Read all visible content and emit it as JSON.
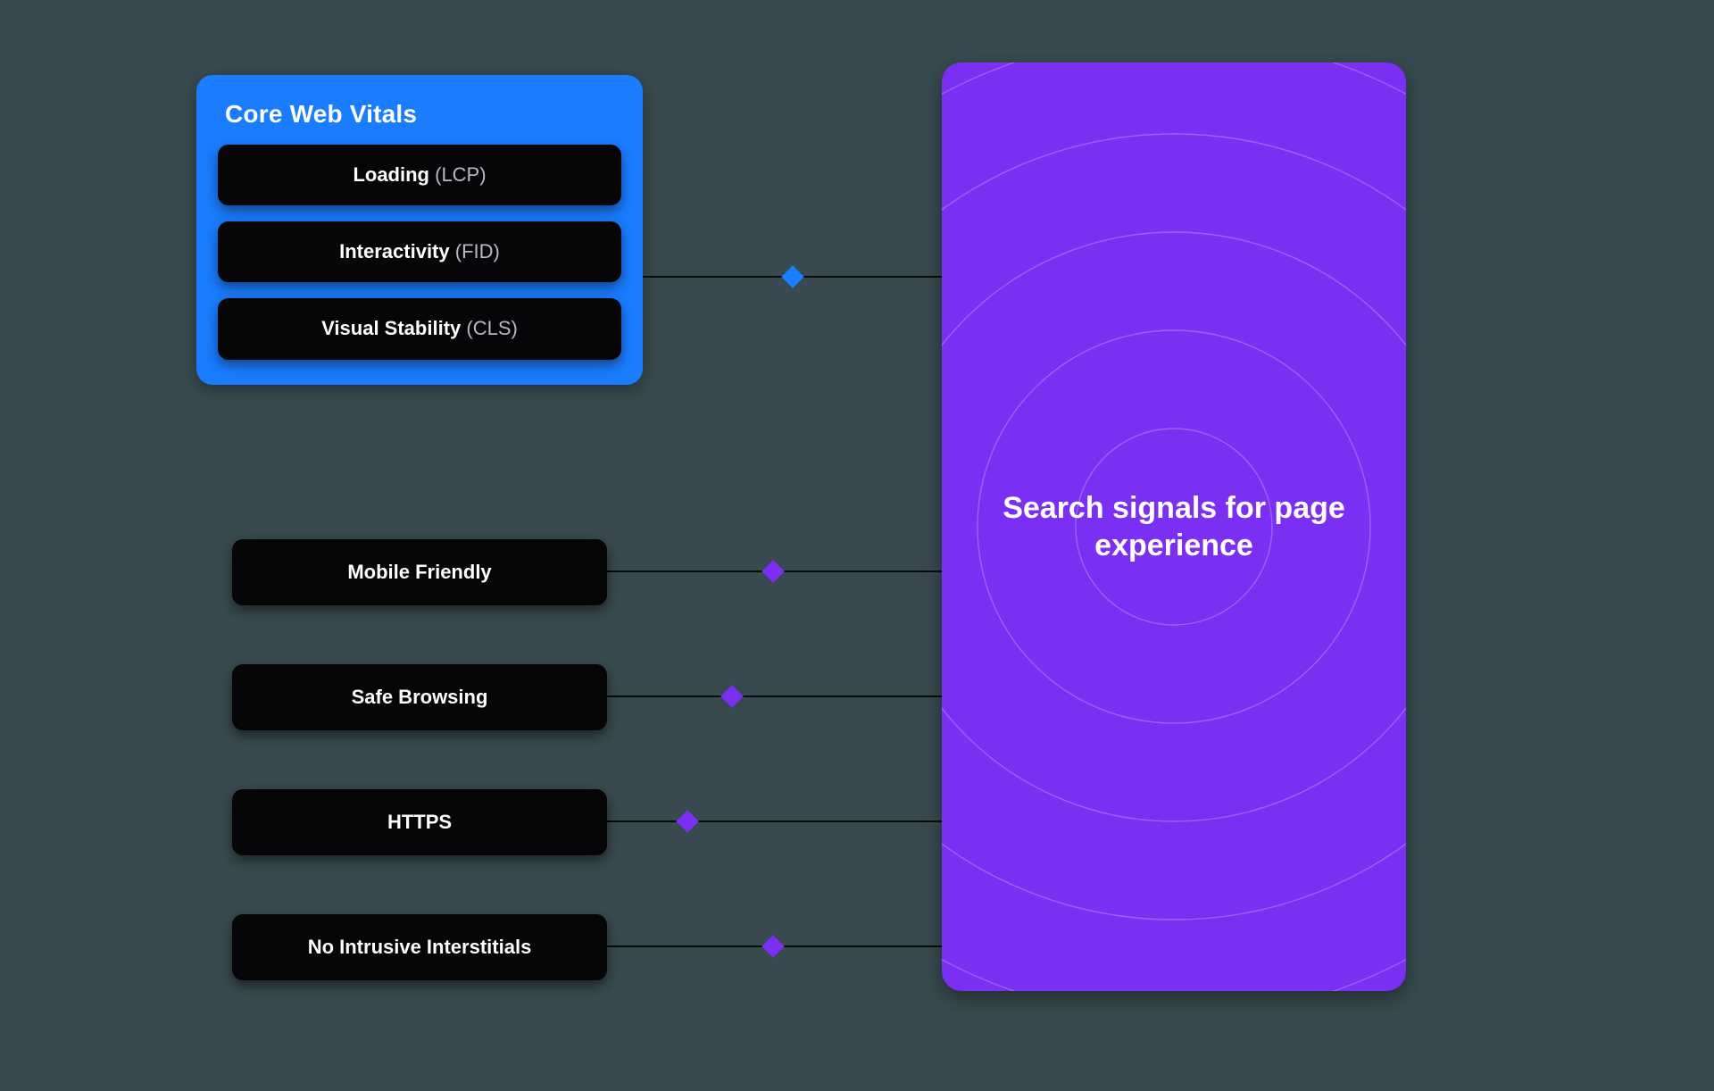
{
  "colors": {
    "background": "#384a4f",
    "cwv_card": "#1a7dff",
    "pill": "#060608",
    "target": "#7b2ff2",
    "diamond_blue": "#1a7dff",
    "diamond_purple": "#7b2ff2"
  },
  "cwv": {
    "title": "Core Web Vitals",
    "items": [
      {
        "name": "Loading",
        "abbr": "LCP"
      },
      {
        "name": "Interactivity",
        "abbr": "FID"
      },
      {
        "name": "Visual Stability",
        "abbr": "CLS"
      }
    ]
  },
  "signals": [
    {
      "label": "Mobile Friendly"
    },
    {
      "label": "Safe Browsing"
    },
    {
      "label": "HTTPS"
    },
    {
      "label": "No Intrusive Interstitials"
    }
  ],
  "target": {
    "label": "Search signals for page experience"
  }
}
